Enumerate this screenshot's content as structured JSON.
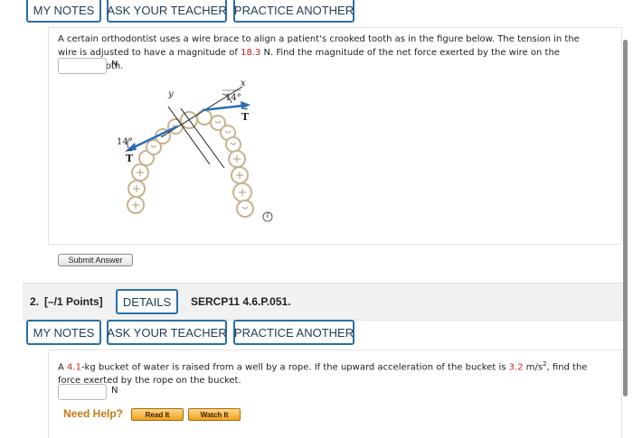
{
  "top_buttons": {
    "my_notes": "MY NOTES",
    "ask_teacher": "ASK YOUR TEACHER",
    "practice": "PRACTICE ANOTHER"
  },
  "q1": {
    "text_before": "A certain orthodontist uses a wire brace to align a patient's crooked tooth as in the figure below. The tension in the wire is adjusted to have a magnitude of ",
    "value": "18.3",
    "text_after": " N. Find the magnitude of the net force exerted by the wire on the crooked tooth.",
    "unit": "N",
    "figure": {
      "angle_left": "14°",
      "angle_right": "14°",
      "tension_label": "T",
      "x_label": "x",
      "y_label": "y",
      "info_icon": "i"
    },
    "submit_label": "Submit Answer"
  },
  "q2": {
    "number": "2.",
    "points": "[–/1 Points]",
    "details": "DETAILS",
    "code": "SERCP11 4.6.P.051.",
    "my_notes": "MY NOTES",
    "ask_teacher": "ASK YOUR TEACHER",
    "practice": "PRACTICE ANOTHER",
    "text_1": "A ",
    "mass": "4.1",
    "text_2": "-kg bucket of water is raised from a well by a rope. If the upward acceleration of the bucket is ",
    "accel": "3.2",
    "text_3": " m/s",
    "text_exp": "2",
    "text_4": ", find the force exerted by the rope on the bucket.",
    "unit": "N",
    "need_help": "Need Help?",
    "read_it": "Read It",
    "watch_it": "Watch It"
  },
  "colors": {
    "button_border": "#2b6fa6",
    "value_red": "#c8261e",
    "arrow_blue": "#2a6db8",
    "need_help": "#c77a12"
  }
}
